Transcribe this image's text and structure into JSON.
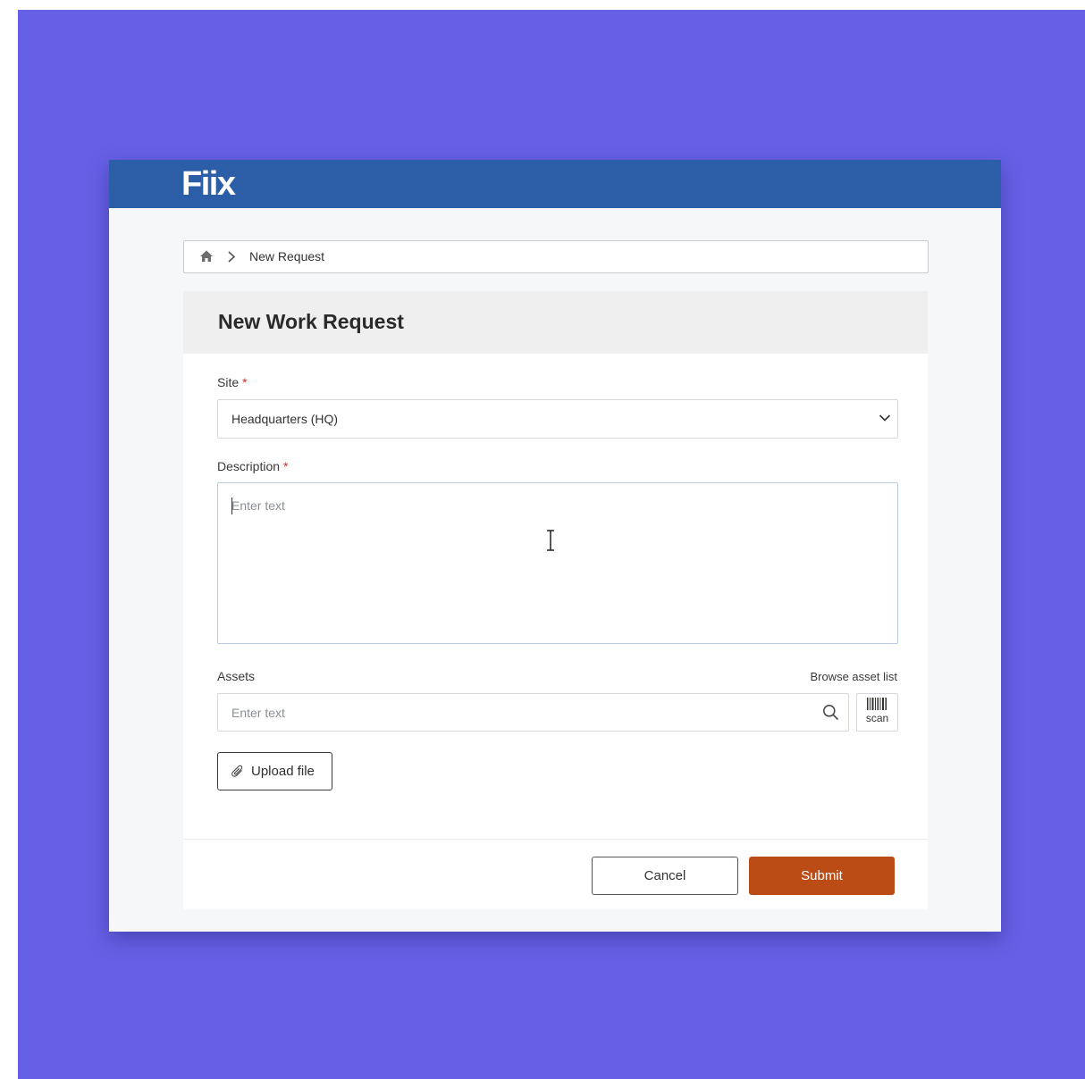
{
  "app": {
    "logo_text": "Fiix"
  },
  "breadcrumb": {
    "home_icon": "home-icon",
    "separator_icon": "chevron-right-icon",
    "current": "New Request"
  },
  "form": {
    "title": "New Work Request",
    "site": {
      "label": "Site",
      "required_mark": "*",
      "value": "Headquarters (HQ)",
      "icon": "chevron-down-icon"
    },
    "description": {
      "label": "Description",
      "required_mark": "*",
      "placeholder": "Enter text"
    },
    "assets": {
      "label": "Assets",
      "browse_link": "Browse asset list",
      "placeholder": "Enter text",
      "search_icon": "search-icon",
      "scan_label": "scan",
      "scan_icon": "barcode-icon"
    },
    "upload": {
      "label": "Upload file",
      "icon": "paperclip-icon"
    }
  },
  "footer": {
    "cancel_label": "Cancel",
    "submit_label": "Submit"
  },
  "colors": {
    "backdrop": "#6660e6",
    "topbar": "#2c5ea8",
    "submit": "#bb4c15",
    "required": "#d42b2b"
  }
}
